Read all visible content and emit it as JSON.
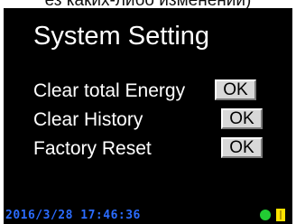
{
  "caption": "ез каких-либо изменений)",
  "screen": {
    "title": "System Setting",
    "settings": [
      {
        "label": "Clear total Energy",
        "button_label": "OK"
      },
      {
        "label": "Clear History",
        "button_label": "OK"
      },
      {
        "label": "Factory Reset",
        "button_label": "OK"
      }
    ]
  },
  "status_bar": {
    "datetime": "2016/3/28 17:46:36",
    "datetime_color": "#2b6cff",
    "indicators": [
      {
        "icon": "status-dot-icon",
        "color": "#22cc33"
      },
      {
        "icon": "status-bar-icon",
        "color": "#ffe200"
      }
    ]
  }
}
